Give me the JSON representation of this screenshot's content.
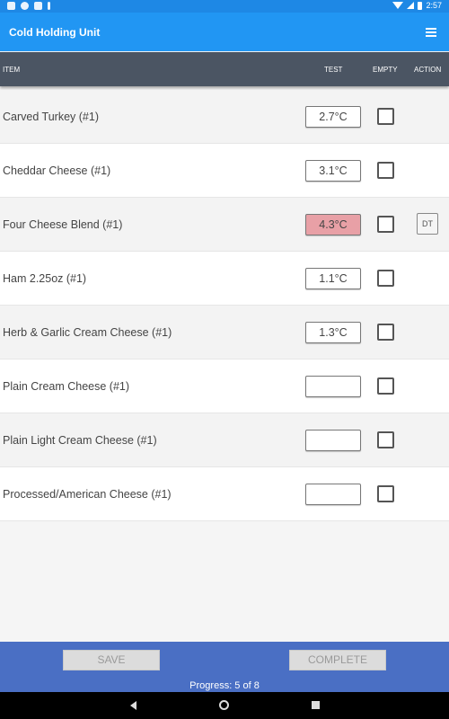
{
  "statusbar": {
    "time": "2:57"
  },
  "appbar": {
    "title": "Cold Holding Unit"
  },
  "table": {
    "headers": {
      "item": "ITEM",
      "test": "TEST",
      "empty": "EMPTY",
      "action": "ACTION"
    },
    "rows": [
      {
        "name": "Carved Turkey (#1)",
        "temp": "2.7°C",
        "alert": false,
        "action": ""
      },
      {
        "name": "Cheddar Cheese (#1)",
        "temp": "3.1°C",
        "alert": false,
        "action": ""
      },
      {
        "name": "Four Cheese Blend (#1)",
        "temp": "4.3°C",
        "alert": true,
        "action": "DT"
      },
      {
        "name": "Ham 2.25oz (#1)",
        "temp": "1.1°C",
        "alert": false,
        "action": ""
      },
      {
        "name": "Herb & Garlic Cream Cheese (#1)",
        "temp": "1.3°C",
        "alert": false,
        "action": ""
      },
      {
        "name": "Plain Cream Cheese (#1)",
        "temp": "",
        "alert": false,
        "action": ""
      },
      {
        "name": "Plain Light Cream Cheese (#1)",
        "temp": "",
        "alert": false,
        "action": ""
      },
      {
        "name": "Processed/American Cheese (#1)",
        "temp": "",
        "alert": false,
        "action": ""
      }
    ]
  },
  "footer": {
    "save_label": "SAVE",
    "complete_label": "COMPLETE",
    "progress": "Progress: 5 of 8"
  },
  "colors": {
    "appbar": "#2196f3",
    "header": "#4b5563",
    "alert": "#e8a0a6",
    "footer": "#4a6fc4"
  }
}
